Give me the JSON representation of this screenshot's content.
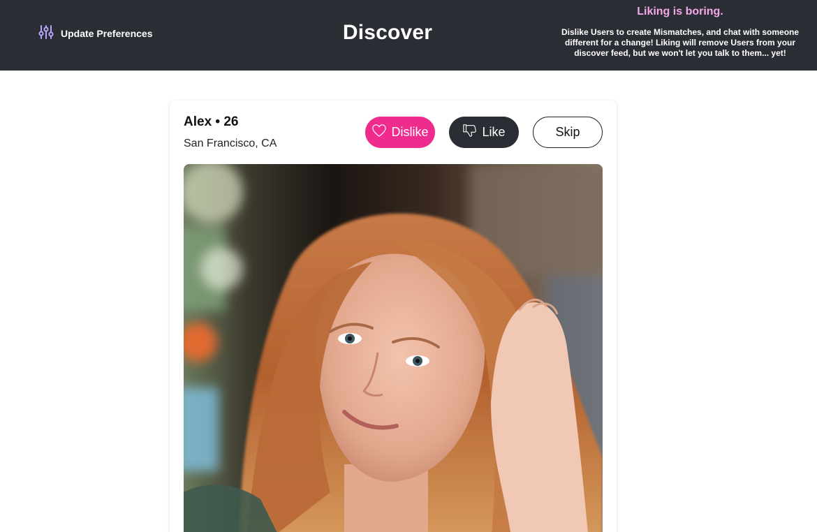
{
  "header": {
    "prefs_label": "Update Preferences",
    "prefs_icon": "sliders-icon",
    "title": "Discover",
    "promo_title": "Liking is boring.",
    "promo_body": "Dislike Users to create Mismatches, and chat with someone different for a change! Liking will remove Users from your discover feed, but we won't let you talk to them... yet!",
    "background": "#2a2d33",
    "promo_accent": "#f4a7e9"
  },
  "profile": {
    "name": "Alex • 26",
    "location": "San Francisco, CA"
  },
  "actions": {
    "dislike_label": "Dislike",
    "dislike_icon": "heart-icon",
    "dislike_color": "#f02b8e",
    "like_label": "Like",
    "like_icon": "thumbs-down-icon",
    "like_color": "#2a2d33",
    "skip_label": "Skip"
  }
}
